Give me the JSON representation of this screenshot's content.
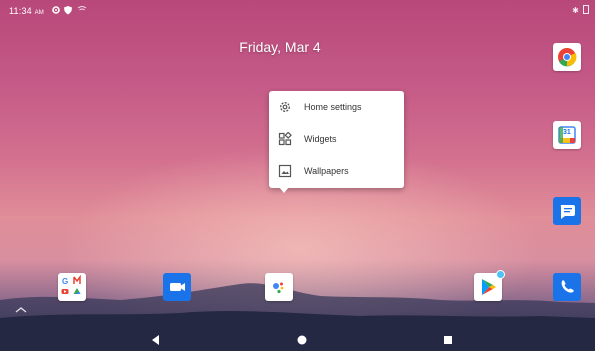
{
  "status_bar": {
    "time": "11:34",
    "ampm": "AM",
    "icons": [
      "gear-icon",
      "shield-icon",
      "cast-icon"
    ],
    "right_icons": [
      "bluetooth-icon",
      "battery-icon"
    ]
  },
  "home": {
    "date": "Friday, Mar 4"
  },
  "context_menu": {
    "items": [
      {
        "label": "Home settings",
        "icon": "settings-gear-icon"
      },
      {
        "label": "Widgets",
        "icon": "widgets-icon"
      },
      {
        "label": "Wallpapers",
        "icon": "wallpapers-icon"
      }
    ]
  },
  "apps": {
    "right_column": [
      "Chrome",
      "Calendar",
      "Messages",
      "Phone"
    ],
    "dock": [
      "Google apps folder",
      "Duo",
      "Assistant",
      "Play Store"
    ],
    "calendar_day": "31"
  },
  "colors": {
    "accent_blue": "#1a73e8",
    "menu_bg": "#ffffff",
    "menu_text": "#333333"
  },
  "navigation": {
    "buttons": [
      "back-icon",
      "home-icon",
      "recents-icon"
    ]
  }
}
